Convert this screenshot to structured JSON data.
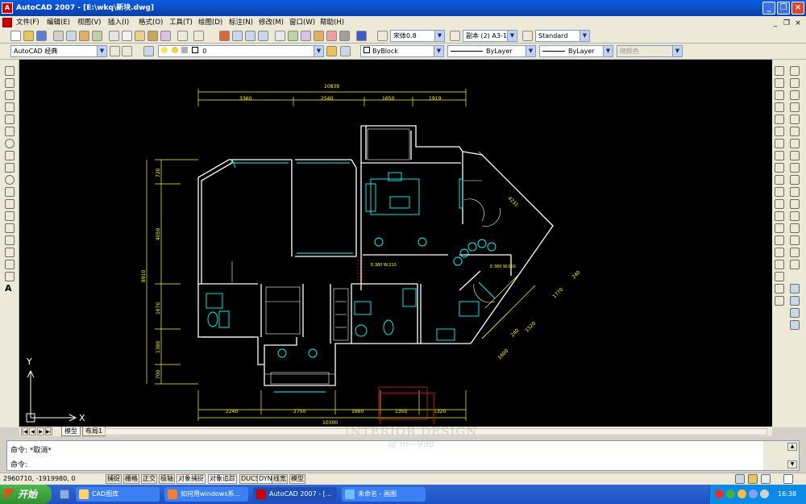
{
  "window": {
    "title": "AutoCAD 2007 - [E:\\wkq\\新块.dwg]",
    "app_icon": "autocad-icon",
    "controls": [
      "minimize",
      "maximize",
      "close"
    ]
  },
  "menubar": {
    "items": [
      "文件(F)",
      "编辑(E)",
      "视图(V)",
      "插入(I)",
      "格式(O)",
      "工具(T)",
      "绘图(D)",
      "标注(N)",
      "修改(M)",
      "窗口(W)",
      "帮助(H)"
    ],
    "doc_controls": [
      "_",
      "❐",
      "×"
    ]
  },
  "toolbar_standard": {
    "text_style_font": "宋体0.8",
    "dim_style": "副本 (2) A3-1",
    "table_style": "Standard"
  },
  "toolbar_row2": {
    "workspace": "AutoCAD 经典",
    "layer": "0",
    "color": "ByBlock",
    "linetype": "ByLayer",
    "lineweight": "ByLayer",
    "plotstyle": "随颜色"
  },
  "drawing": {
    "dims_top": {
      "overall": "10839",
      "parts": [
        "3360",
        "2540",
        "1650",
        "1919"
      ]
    },
    "dims_bottom": {
      "overall": "10300",
      "parts": [
        "2240",
        "2750",
        "1660",
        "1350",
        "1320"
      ]
    },
    "dims_left": {
      "overall": "8910",
      "parts": [
        "720",
        "4050",
        "1670",
        "1380",
        "700"
      ]
    },
    "dims_diag": [
      "4231",
      "1770",
      "240",
      "1520",
      "240",
      "1600"
    ],
    "annotations": [
      "E:380\nW:210",
      "E:380\nW:210"
    ],
    "ucs": {
      "x": "X",
      "y": "Y"
    }
  },
  "layout_tabs": {
    "active": "模型",
    "other": "布局1"
  },
  "command": {
    "line1": "命令:  *取消*",
    "line2": "命令:"
  },
  "status": {
    "coords": "2960710, -1919980, 0",
    "buttons": [
      "捕捉",
      "栅格",
      "正交",
      "极轴",
      "对象捕捉",
      "对象追踪",
      "DUCS",
      "DYN",
      "线宽",
      "模型"
    ]
  },
  "taskbar": {
    "start": "开始",
    "tasks": [
      "CAD图库",
      "如何用windows系...",
      "AutoCAD 2007 - [...",
      "未命名 - 画图"
    ],
    "active_task": 2,
    "clock": "16:38"
  },
  "watermark": {
    "line1": "INTERIOR DESIGN",
    "line2": "@ m—998"
  },
  "colors": {
    "titlebar": "#0a4ed0",
    "canvas": "#000000",
    "wall": "#ffffff",
    "furniture": "#00ffff",
    "dimension": "#ffff00",
    "taskbar": "#245edb"
  }
}
